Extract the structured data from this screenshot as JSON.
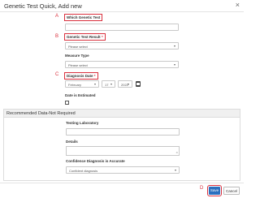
{
  "dialog": {
    "title": "Genetic Test Quick, Add new",
    "close_glyph": "×"
  },
  "markers": {
    "a": "A",
    "b": "B",
    "c": "C",
    "d": "D"
  },
  "fields": {
    "which_test": {
      "label": "Which Genetic Test"
    },
    "result": {
      "label": "Genetic Test Result",
      "required": "*",
      "value": "Please select"
    },
    "measure_type": {
      "label": "Measure Type",
      "value": "Please select"
    },
    "diagnosis_date": {
      "label": "Diagnosis Date",
      "required": "*",
      "month": "February",
      "day": "17",
      "year": "2022"
    },
    "date_estimated": {
      "label": "Date is Estimated"
    }
  },
  "recommended": {
    "title": "Recommended Data-Not Required",
    "testing_lab": {
      "label": "Testing Laboratory"
    },
    "details": {
      "label": "Details"
    },
    "confidence": {
      "label": "Confidence Diagnosis is Accurate",
      "value": "Confident diagnosis"
    }
  },
  "buttons": {
    "save": "Save",
    "cancel": "Cancel"
  },
  "colors": {
    "annotation": "#d9303d",
    "primary": "#2a6fbf"
  }
}
